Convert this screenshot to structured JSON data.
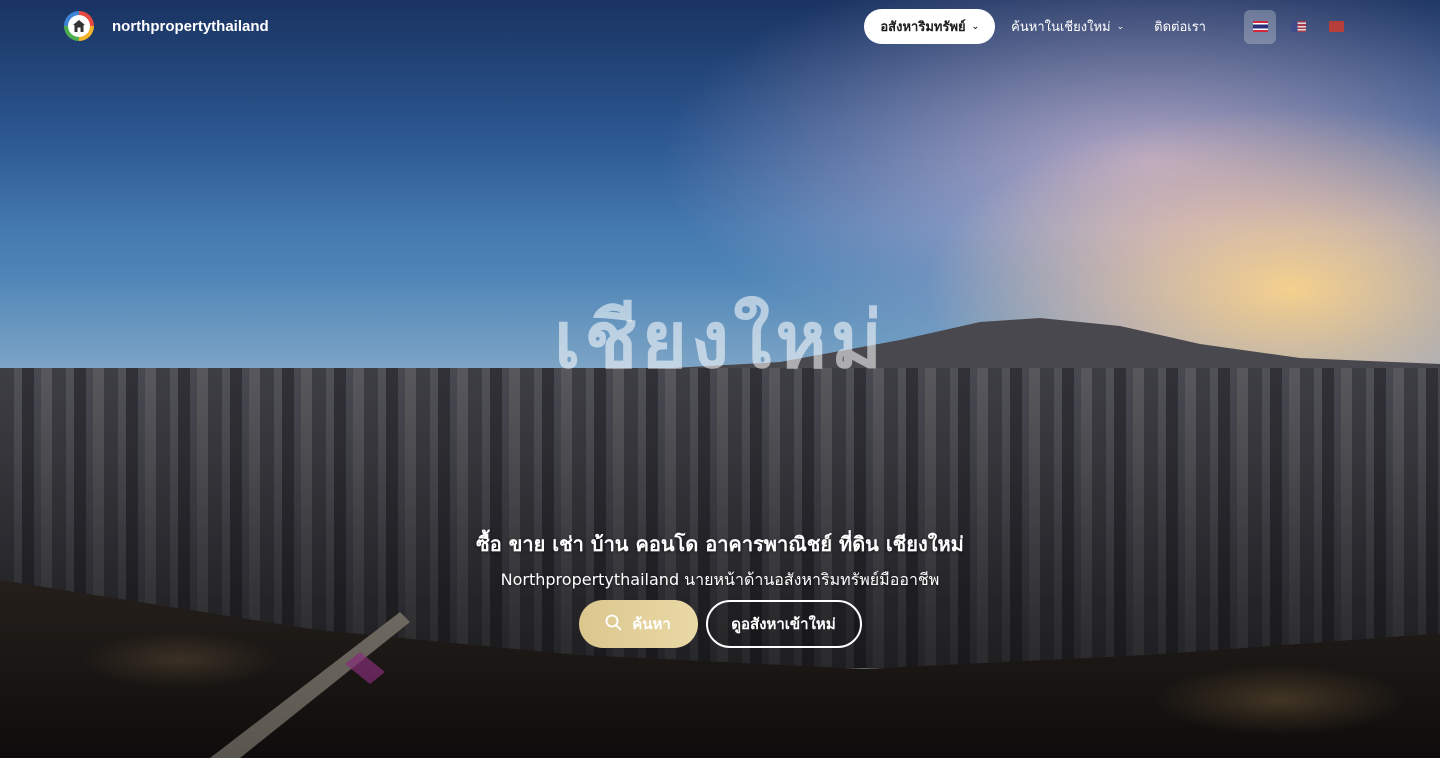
{
  "header": {
    "brand_name": "northpropertythailand",
    "nav": {
      "properties_label": "อสังหาริมทรัพย์",
      "search_chiangmai_label": "ค้นหาในเชียงใหม่",
      "contact_label": "ติดต่อเรา"
    },
    "languages": [
      {
        "code": "th",
        "icon": "thailand-flag-icon",
        "active": true
      },
      {
        "code": "en",
        "icon": "usa-flag-icon",
        "active": false
      },
      {
        "code": "zh",
        "icon": "china-flag-icon",
        "active": false
      }
    ]
  },
  "hero": {
    "watermark": "เชียงใหม่",
    "title": "ซื้อ ขาย เช่า บ้าน คอนโด อาคารพาณิชย์ ที่ดิน เชียงใหม่",
    "subtitle": "Northpropertythailand นายหน้าด้านอสังหาริมทรัพย์มืออาชีพ",
    "search_button": "ค้นหา",
    "new_listings_button": "ดูอสังหาเข้าใหม่"
  },
  "colors": {
    "search_button_gold": "#dcc68e",
    "nav_pill_bg": "#ffffff"
  }
}
